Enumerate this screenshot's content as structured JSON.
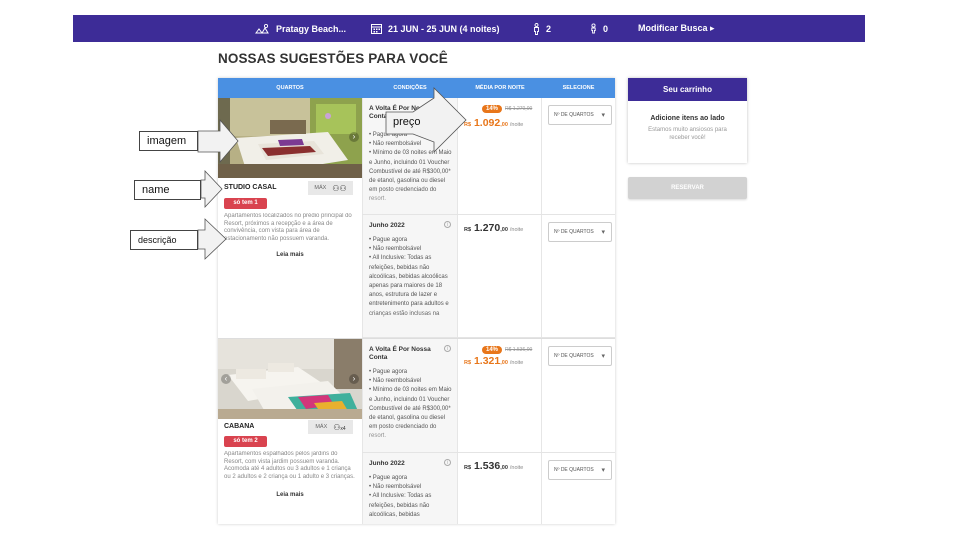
{
  "topbar": {
    "location": "Pratagy Beach...",
    "dates": "21 JUN - 25 JUN (4 noites)",
    "adults": "2",
    "children": "0",
    "modify_label": "Modificar Busca ▸"
  },
  "page_title": "NOSSAS SUGESTÕES PARA VOCÊ",
  "table_headers": [
    "QUARTOS",
    "CONDIÇÕES",
    "MÉDIA POR NOITE",
    "SELECIONE"
  ],
  "rooms": [
    {
      "name": "STUDIO CASAL",
      "max_label": "MÁX",
      "capacity_icon": "two-people",
      "capacity_text": "",
      "availability": "só tem 1",
      "description": "Apartamentos localizados no prédio principal do Resort, próximos a recepção e a área de convivência, com vista para área de estacionamento não possuem varanda.",
      "read_more": "Leia mais",
      "offers": [
        {
          "title": "A Volta É Por Nossa Conta",
          "items": [
            "Pague agora",
            "Não reembolsável",
            "Mínimo de 03 noites em Maio e Junho, incluindo 01 Voucher Combustível de até R$300,00* de etanol, gasolina ou diesel em posto credenciado do resort."
          ],
          "discount": "14%",
          "old_price": "R$ 1.270,00",
          "currency": "R$",
          "price": "1.092",
          "cents": ",00",
          "per": "/noite",
          "select_label": "Nº DE QUARTOS"
        },
        {
          "title": "Junho 2022",
          "items": [
            "Pague agora",
            "Não reembolsável",
            "All Inclusive: Todas as refeições, bebidas não alcoólicas, bebidas alcoólicas apenas para maiores de 18 anos, estrutura de lazer e entretenimento para adultos e crianças estão inclusas na"
          ],
          "discount": "",
          "old_price": "",
          "currency": "R$",
          "price": "1.270",
          "cents": ",00",
          "per": "/noite",
          "select_label": "Nº DE QUARTOS"
        }
      ]
    },
    {
      "name": "CABANA",
      "max_label": "MÁX",
      "capacity_icon": "person",
      "capacity_text": "x4",
      "availability": "só tem 2",
      "description": "Apartamentos espalhados pelos jardins do Resort, com vista jardim possuem varanda. Acomoda até 4 adultos ou 3 adultos e 1 criança ou 2 adultos e 2 criança ou 1 adulto e 3 crianças. não possuem varanda.",
      "read_more": "Leia mais",
      "offers": [
        {
          "title": "A Volta É Por Nossa Conta",
          "items": [
            "Pague agora",
            "Não reembolsável",
            "Mínimo de 03 noites em Maio e Junho, incluindo 01 Voucher Combustível de até R$300,00* de etanol, gasolina ou diesel em posto credenciado do resort."
          ],
          "discount": "14%",
          "old_price": "R$ 1.536,00",
          "currency": "R$",
          "price": "1.321",
          "cents": ",00",
          "per": "/noite",
          "select_label": "Nº DE QUARTOS"
        },
        {
          "title": "Junho 2022",
          "items": [
            "Pague agora",
            "Não reembolsável",
            "All Inclusive: Todas as refeições, bebidas não alcoólicas, bebidas"
          ],
          "discount": "",
          "old_price": "",
          "currency": "R$",
          "price": "1.536",
          "cents": ",00",
          "per": "/noite",
          "select_label": "Nº DE QUARTOS"
        }
      ]
    }
  ],
  "cart": {
    "title": "Seu carrinho",
    "subtitle": "Adicione itens ao lado",
    "text": "Estamos muito ansiosos para receber você!",
    "reserve_label": "RESERVAR"
  },
  "annotations": {
    "image": "imagem",
    "name": "name",
    "description": "descrição",
    "price": "preço"
  },
  "colors": {
    "brand": "#3d2c97",
    "header_blue": "#4a90e2",
    "discount_orange": "#e8761a",
    "badge_red": "#d9434f"
  }
}
